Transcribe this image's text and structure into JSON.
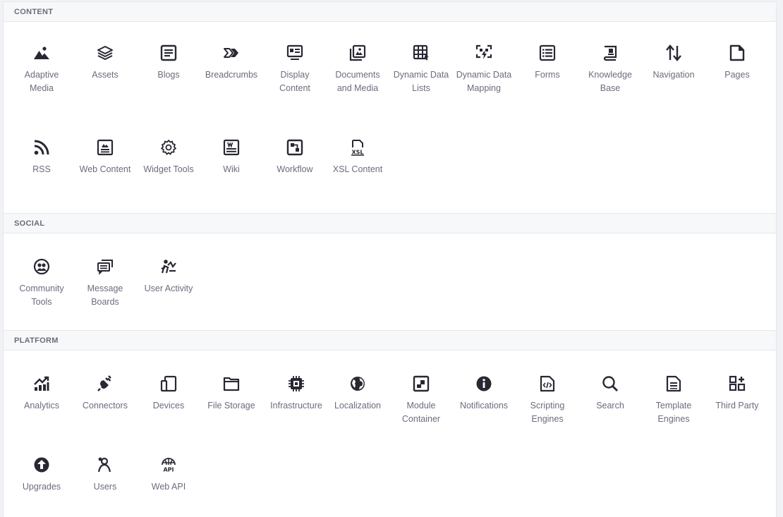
{
  "sections": [
    {
      "title": "CONTENT",
      "items": [
        {
          "label": "Adaptive Media",
          "icon": "adaptive-media-icon"
        },
        {
          "label": "Assets",
          "icon": "assets-icon"
        },
        {
          "label": "Blogs",
          "icon": "blogs-icon"
        },
        {
          "label": "Breadcrumbs",
          "icon": "breadcrumbs-icon"
        },
        {
          "label": "Display Content",
          "icon": "display-content-icon"
        },
        {
          "label": "Documents and Media",
          "icon": "documents-media-icon"
        },
        {
          "label": "Dynamic Data Lists",
          "icon": "dynamic-data-lists-icon"
        },
        {
          "label": "Dynamic Data Mapping",
          "icon": "dynamic-data-mapping-icon"
        },
        {
          "label": "Forms",
          "icon": "forms-icon"
        },
        {
          "label": "Knowledge Base",
          "icon": "knowledge-base-icon"
        },
        {
          "label": "Navigation",
          "icon": "navigation-icon"
        },
        {
          "label": "Pages",
          "icon": "pages-icon"
        },
        {
          "label": "RSS",
          "icon": "rss-icon"
        },
        {
          "label": "Web Content",
          "icon": "web-content-icon"
        },
        {
          "label": "Widget Tools",
          "icon": "widget-tools-icon"
        },
        {
          "label": "Wiki",
          "icon": "wiki-icon"
        },
        {
          "label": "Workflow",
          "icon": "workflow-icon"
        },
        {
          "label": "XSL Content",
          "icon": "xsl-content-icon"
        }
      ]
    },
    {
      "title": "SOCIAL",
      "items": [
        {
          "label": "Community Tools",
          "icon": "community-tools-icon"
        },
        {
          "label": "Message Boards",
          "icon": "message-boards-icon"
        },
        {
          "label": "User Activity",
          "icon": "user-activity-icon"
        }
      ]
    },
    {
      "title": "PLATFORM",
      "items": [
        {
          "label": "Analytics",
          "icon": "analytics-icon"
        },
        {
          "label": "Connectors",
          "icon": "connectors-icon"
        },
        {
          "label": "Devices",
          "icon": "devices-icon"
        },
        {
          "label": "File Storage",
          "icon": "file-storage-icon"
        },
        {
          "label": "Infrastructure",
          "icon": "infrastructure-icon"
        },
        {
          "label": "Localization",
          "icon": "localization-icon"
        },
        {
          "label": "Module Container",
          "icon": "module-container-icon"
        },
        {
          "label": "Notifications",
          "icon": "notifications-icon"
        },
        {
          "label": "Scripting Engines",
          "icon": "scripting-engines-icon"
        },
        {
          "label": "Search",
          "icon": "search-icon"
        },
        {
          "label": "Template Engines",
          "icon": "template-engines-icon"
        },
        {
          "label": "Third Party",
          "icon": "third-party-icon"
        },
        {
          "label": "Upgrades",
          "icon": "upgrades-icon"
        },
        {
          "label": "Users",
          "icon": "users-icon"
        },
        {
          "label": "Web API",
          "icon": "web-api-icon"
        }
      ]
    }
  ]
}
